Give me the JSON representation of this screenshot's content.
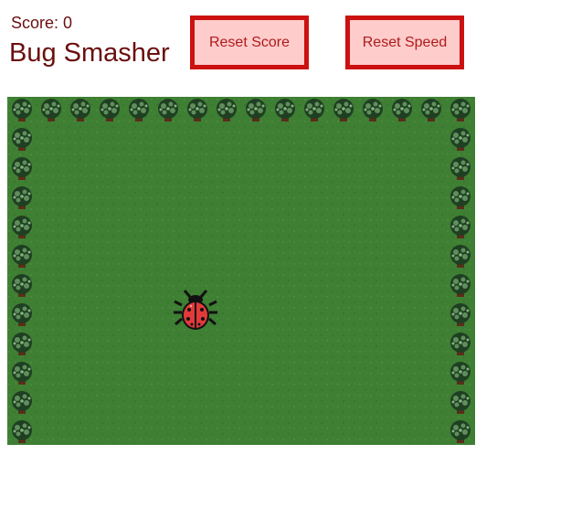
{
  "hud": {
    "score_text": "Score: 0",
    "title": "Bug Smasher"
  },
  "buttons": {
    "reset_score": "Reset Score",
    "reset_speed": "Reset Speed"
  },
  "game": {
    "score": 0,
    "background": "grass-field",
    "border": "bush-hedge",
    "bug": "ladybug",
    "colors": {
      "grass": "#3e7f33",
      "bush_dark": "#1f3f22",
      "bush_light": "#5f8f5b",
      "bug_red": "#e23a3a",
      "bug_black": "#111111",
      "text": "#6b0f0f",
      "button_fill": "#ffcccc",
      "button_border": "#cc1111"
    }
  }
}
